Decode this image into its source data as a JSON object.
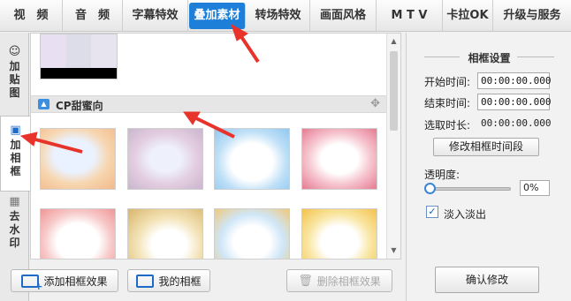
{
  "top_tabs": [
    {
      "label": "视　频"
    },
    {
      "label": "音　频"
    },
    {
      "label": "字幕特效"
    },
    {
      "label": "叠加素材"
    },
    {
      "label": "转场特效"
    },
    {
      "label": "画面风格"
    },
    {
      "label": "M T V"
    },
    {
      "label": "卡拉OK"
    },
    {
      "label": "升级与服务"
    }
  ],
  "active_top_tab": "叠加素材",
  "side_tabs": [
    {
      "label_line1": "加",
      "label_line2": "贴",
      "label_line3": "图",
      "icon": "sticker-icon"
    },
    {
      "label_line1": "加",
      "label_line2": "相",
      "label_line3": "框",
      "icon": "frame-icon"
    },
    {
      "label_line1": "去",
      "label_line2": "水",
      "label_line3": "印",
      "icon": "mosaic-icon"
    }
  ],
  "category": {
    "title": "CP甜蜜向",
    "icon": "image-icon"
  },
  "frames": [
    {
      "name": "frame-orange-wave"
    },
    {
      "name": "frame-pink-haze"
    },
    {
      "name": "frame-blue-hearts"
    },
    {
      "name": "frame-pink-hearts"
    },
    {
      "name": "frame-red-border"
    },
    {
      "name": "frame-music-notes"
    },
    {
      "name": "frame-yellow-corner"
    },
    {
      "name": "frame-yellow-stars"
    }
  ],
  "bottom_buttons": {
    "add_frame": "添加相框效果",
    "my_frames": "我的相框",
    "delete_frame": "删除相框效果"
  },
  "settings": {
    "title": "相框设置",
    "start_label": "开始时间:",
    "start_value": "00:00:00.000",
    "end_label": "结束时间:",
    "end_value": "00:00:00.000",
    "duration_label": "选取时长:",
    "duration_value": "00:00:00.000",
    "edit_range_button": "修改相框时间段",
    "opacity_label": "透明度:",
    "opacity_value": "0%",
    "opacity_level": 0,
    "fade_checked": true,
    "fade_label": "淡入淡出",
    "confirm_button": "确认修改"
  },
  "colors": {
    "accent": "#1e7fd9",
    "arrow": "#e8332a"
  }
}
